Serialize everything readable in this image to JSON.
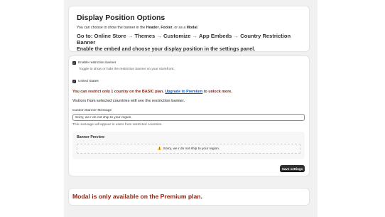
{
  "header": {
    "title": "Display Position Options",
    "intro_prefix": "You can choose to show the banner in the ",
    "intro_header": "Header",
    "intro_sep1": ", ",
    "intro_footer": "Footer",
    "intro_sep2": ", or as a ",
    "intro_modal": "Modal",
    "intro_suffix": ".",
    "goto_prefix": "Go to: ",
    "path": [
      "Online Store",
      "Themes",
      "Customize",
      "App Embeds",
      "Country Restriction Banner"
    ],
    "arrow": "→",
    "enable_text": "Enable the embed and choose your display position in the settings panel."
  },
  "settings": {
    "enable_label": "Enable restriction banner",
    "enable_checked": true,
    "enable_help": "Toggle to show or hide the restriction banner on your storefront.",
    "country_label": "United States",
    "country_checked": true,
    "limit_prefix": "You can restrict only 1 country on the BASIC plan. ",
    "upgrade_link": "Upgrade to Premium",
    "limit_suffix": " to unlock more.",
    "visitors_note": "Visitors from selected countries will see the restriction banner.",
    "message_label": "Custom Banner Message",
    "message_value": "Sorry, we r do not ship to your region.",
    "message_help": "This message will appear to users from restricted countries.",
    "preview_title": "Banner Preview",
    "preview_icon": "⚠️",
    "preview_text": "Sorry, we r do not ship to your region.",
    "save_label": "Save settings"
  },
  "modal_notice": "Modal is only available on the Premium plan.",
  "colors": {
    "warning_text": "#8e1f0b",
    "link": "#005bd3",
    "primary_button": "#303030"
  }
}
